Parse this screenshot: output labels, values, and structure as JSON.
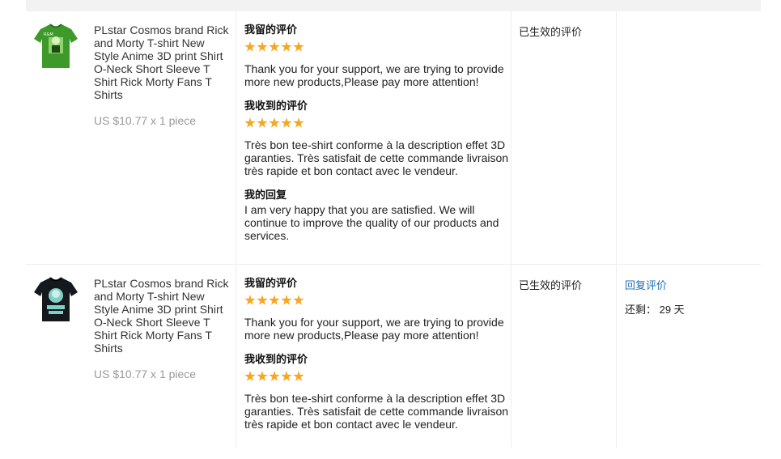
{
  "colors": {
    "star": "#f5a623",
    "link": "#1b6fb8",
    "muted": "#999999"
  },
  "rows": [
    {
      "product_name": "PLstar Cosmos brand Rick and Morty T-shirt New Style Anime 3D print Shirt O-Neck Short Sleeve T Shirt Rick Morty Fans T Shirts",
      "price": "US $10.77 x 1 piece",
      "thumb_color": "green",
      "my_review_title": "我留的评价",
      "my_review_rating": 5,
      "my_review_text": "Thank you for your support, we are trying to provide more new products,Please pay more attention!",
      "received_review_title": "我收到的评价",
      "received_review_rating": 5,
      "received_review_text": "Très bon tee-shirt conforme à la description effet 3D garanties. Très satisfait de cette commande livraison très rapide et bon contact avec le vendeur.",
      "my_reply_title": "我的回复",
      "my_reply_text": "I am very happy that you are satisfied. We will continue to improve the quality of our products and services.",
      "status": "已生效的评价"
    },
    {
      "product_name": "PLstar Cosmos brand Rick and Morty T-shirt New Style Anime 3D print Shirt O-Neck Short Sleeve T Shirt Rick Morty Fans T Shirts",
      "price": "US $10.77 x 1 piece",
      "thumb_color": "black",
      "my_review_title": "我留的评价",
      "my_review_rating": 5,
      "my_review_text": "Thank you for your support, we are trying to provide more new products,Please pay more attention!",
      "received_review_title": "我收到的评价",
      "received_review_rating": 5,
      "received_review_text": "Très bon tee-shirt conforme à la description effet 3D garanties. Très satisfait de cette commande livraison très rapide et bon contact avec le vendeur.",
      "status": "已生效的评价",
      "action_link": "回复评价",
      "remaining": "还剩： 29 天"
    }
  ]
}
